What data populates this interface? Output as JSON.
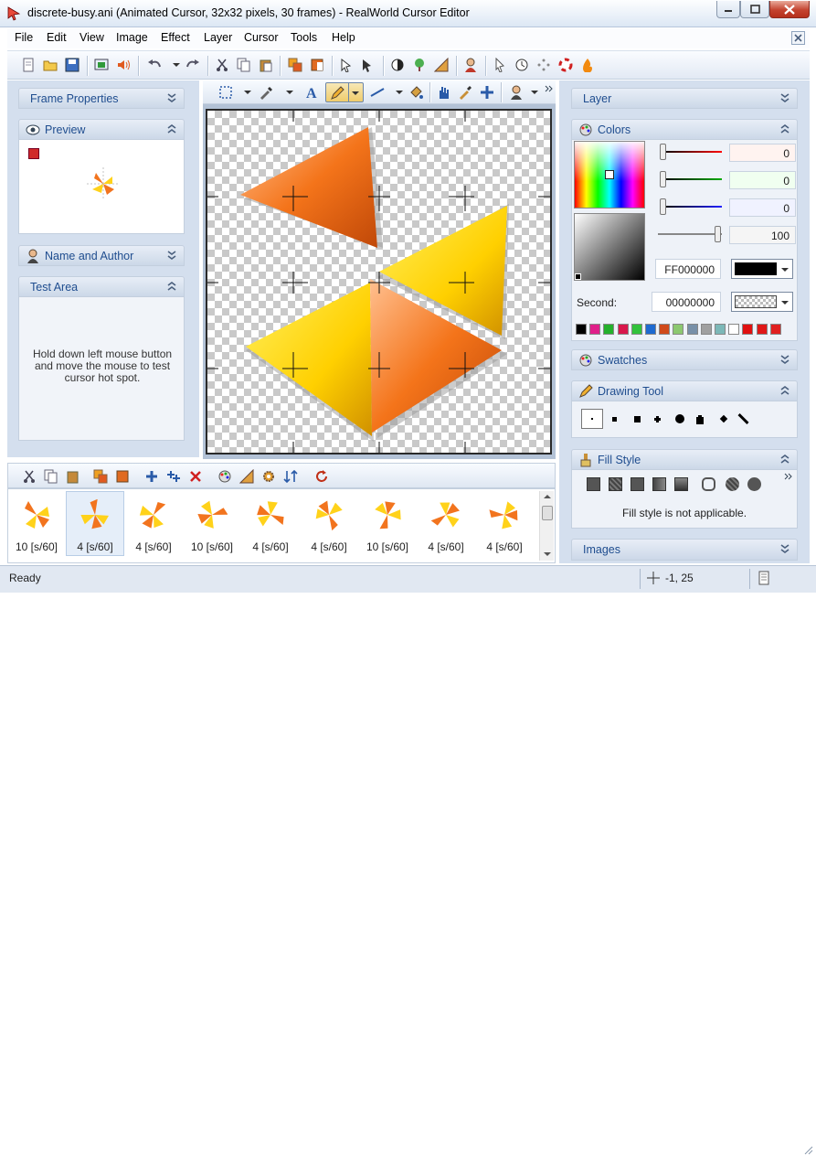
{
  "window": {
    "title": "discrete-busy.ani (Animated Cursor, 32x32 pixels, 30 frames) - RealWorld Cursor Editor"
  },
  "menu": [
    "File",
    "Edit",
    "View",
    "Image",
    "Effect",
    "Layer",
    "Cursor",
    "Tools",
    "Help"
  ],
  "left": {
    "frame_properties": "Frame Properties",
    "preview": "Preview",
    "name_author": "Name and Author",
    "test_area": "Test Area",
    "test_text": "Hold down left mouse button and move the mouse to test cursor hot spot."
  },
  "right": {
    "layer": "Layer",
    "colors": "Colors",
    "red": "0",
    "green": "0",
    "blue": "0",
    "alpha": "100",
    "hex": "FF000000",
    "second_label": "Second:",
    "second_hex": "00000000",
    "swatches": "Swatches",
    "drawing_tool": "Drawing Tool",
    "fill_style": "Fill Style",
    "fill_note": "Fill style is not applicable.",
    "images": "Images"
  },
  "palette": [
    "#000000",
    "#e0208a",
    "#25b12c",
    "#d8184c",
    "#32c23c",
    "#1e6ad0",
    "#d04a1a",
    "#8cc870",
    "#7890a8",
    "#a0a0a0",
    "#7cb8b8",
    "#ffffff",
    "#e01010",
    "#e01818",
    "#e02020"
  ],
  "frames": [
    "10 [s/60]",
    "4 [s/60]",
    "4 [s/60]",
    "10 [s/60]",
    "4 [s/60]",
    "4 [s/60]",
    "10 [s/60]",
    "4 [s/60]",
    "4 [s/60]"
  ],
  "status": {
    "text": "Ready",
    "coords": "-1, 25"
  },
  "colors": {
    "accent": "#1f4d8f",
    "panel": "#d4dfee"
  }
}
